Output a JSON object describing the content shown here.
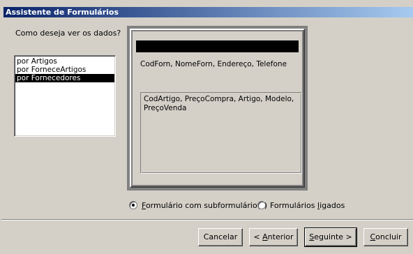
{
  "window": {
    "title": "Assistente de Formulários"
  },
  "prompt": "Como deseja ver os dados?",
  "list": {
    "items": [
      {
        "label": "por Artigos"
      },
      {
        "label": "por ForneceArtigos"
      },
      {
        "label": "por Fornecedores"
      }
    ],
    "selected_index": 2
  },
  "preview": {
    "main_fields": "CodForn, NomeForn, Endereço, Telefone",
    "sub_fields_line1": "CodArtigo, PreçoCompra, Artigo, Modelo,",
    "sub_fields_line2": "PreçoVenda"
  },
  "options": {
    "subform": {
      "accel": "F",
      "rest": "ormulário com subformulário(s)",
      "checked": true
    },
    "linked": {
      "pre": "Formulários ",
      "accel": "l",
      "post": "igados",
      "checked": false
    }
  },
  "buttons": {
    "cancel": "Cancelar",
    "back_pre": "< ",
    "back_accel": "A",
    "back_rest": "nterior",
    "next_accel": "S",
    "next_rest": "eguinte >",
    "finish_accel": "C",
    "finish_rest": "oncluir"
  }
}
